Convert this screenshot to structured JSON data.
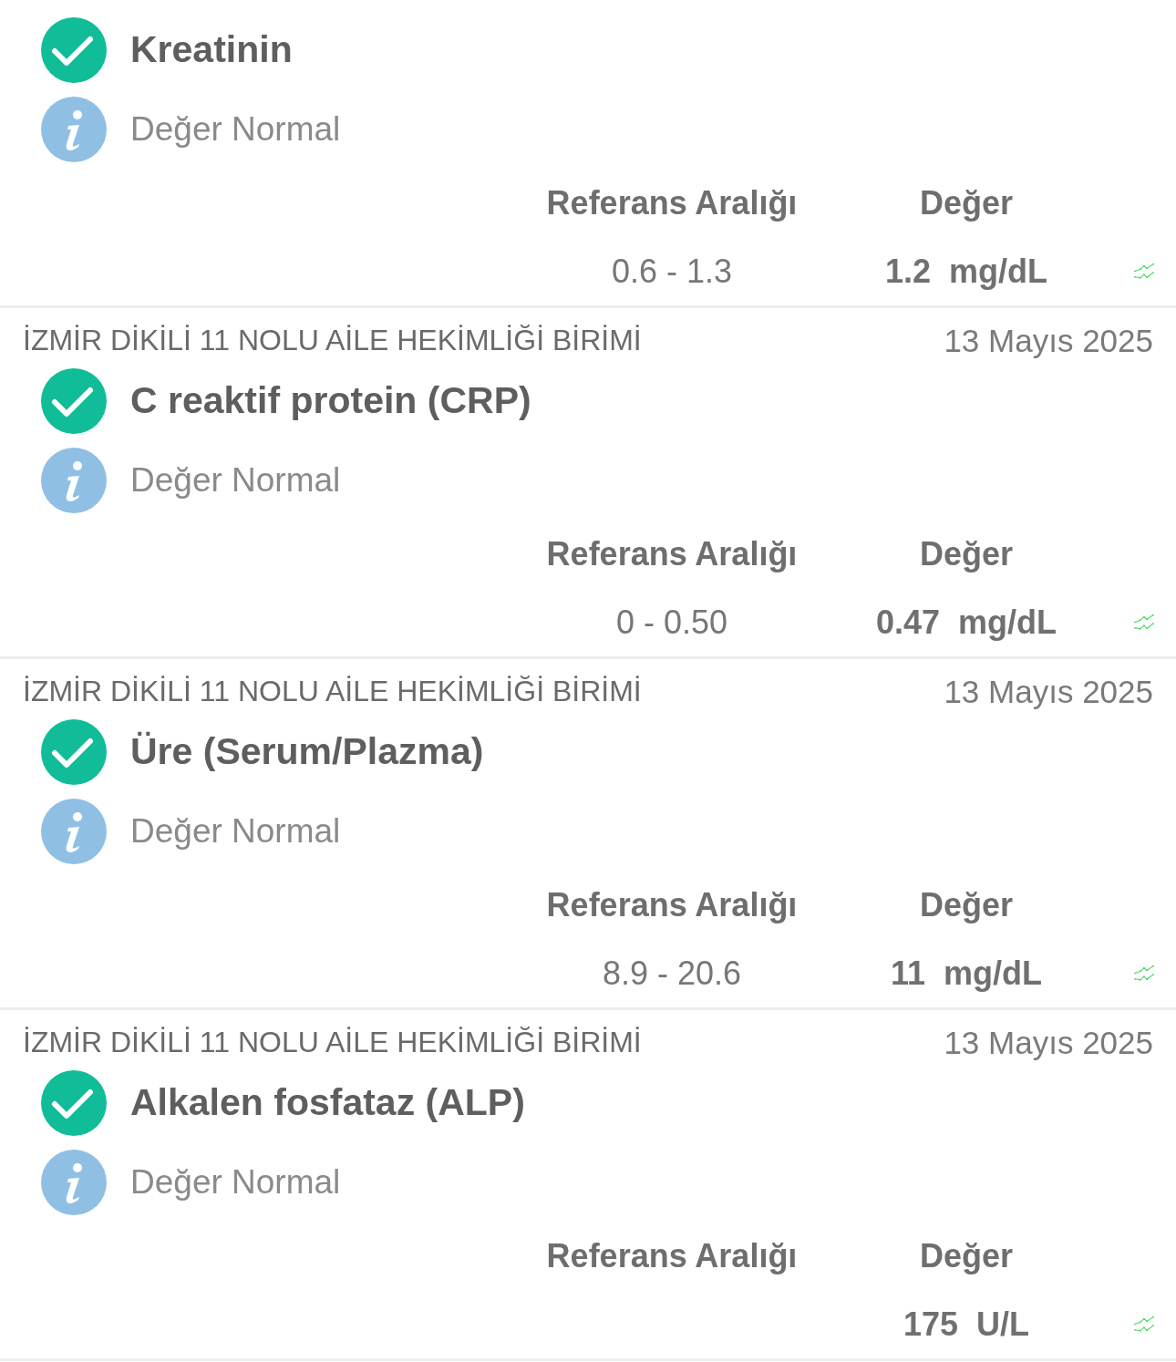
{
  "results": [
    {
      "kind": "normal",
      "name": "Kreatinin",
      "note": "Değer Normal",
      "reference_heading": "Referans Aralığı",
      "value_heading": "Değer",
      "reference_range": "0.6 - 1.3",
      "value": "1.2",
      "unit": "mg/dL"
    },
    {
      "lab": "İZMİR DİKİLİ 11 NOLU AİLE HEKİMLİĞİ BİRİMİ",
      "date": "13 Mayıs 2025",
      "kind": "normal",
      "name": "C reaktif protein (CRP)",
      "note": "Değer Normal",
      "reference_heading": "Referans Aralığı",
      "value_heading": "Değer",
      "reference_range": "0 - 0.50",
      "value": "0.47",
      "unit": "mg/dL"
    },
    {
      "lab": "İZMİR DİKİLİ 11 NOLU AİLE HEKİMLİĞİ BİRİMİ",
      "date": "13 Mayıs 2025",
      "kind": "normal",
      "name": "Üre (Serum/Plazma)",
      "note": "Değer Normal",
      "reference_heading": "Referans Aralığı",
      "value_heading": "Değer",
      "reference_range": "8.9 - 20.6",
      "value": "11",
      "unit": "mg/dL"
    },
    {
      "lab": "İZMİR DİKİLİ 11 NOLU AİLE HEKİMLİĞİ BİRİMİ",
      "date": "13 Mayıs 2025",
      "kind": "normal",
      "name": "Alkalen fosfataz (ALP)",
      "note": "Değer Normal",
      "reference_heading": "Referans Aralığı",
      "value_heading": "Değer",
      "value": "175",
      "unit": "U/L"
    }
  ]
}
